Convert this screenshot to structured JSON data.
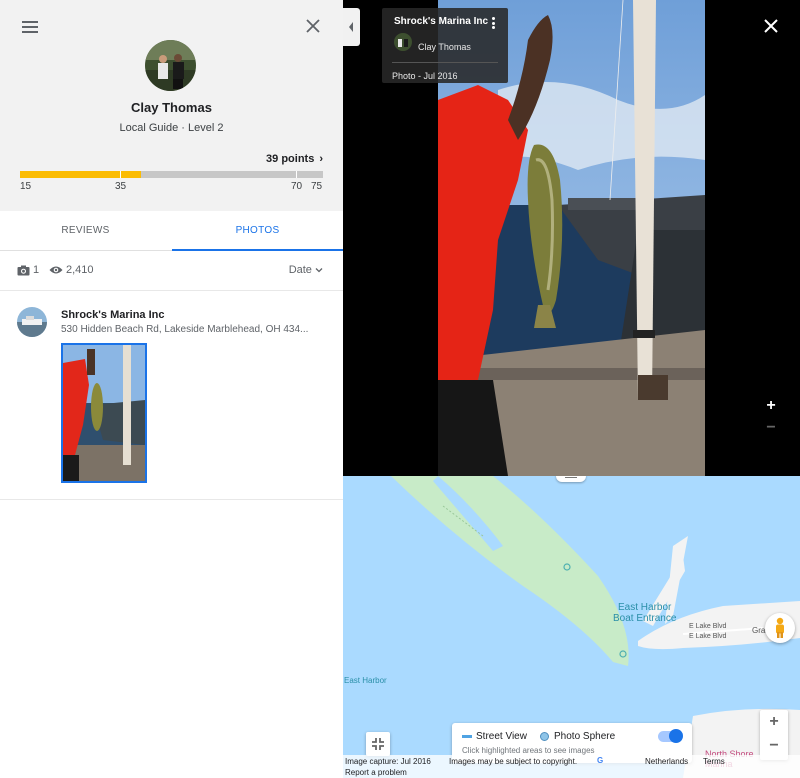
{
  "profile": {
    "name": "Clay Thomas",
    "level": "Local Guide · Level 2",
    "points_label": "39 points",
    "progress": {
      "current_points": 39,
      "max_points": 75,
      "fill_fraction": 0.4,
      "tick_labels": [
        "15",
        "35",
        "70",
        "75"
      ]
    }
  },
  "tabs": [
    {
      "label": "REVIEWS",
      "active": false
    },
    {
      "label": "PHOTOS",
      "active": true
    }
  ],
  "stats": {
    "photo_count": "1",
    "view_count": "2,410",
    "sort_label": "Date"
  },
  "entry": {
    "place_name": "Shrock's Marina Inc",
    "address": "530 Hidden Beach Rd, Lakeside Marblehead, OH 434..."
  },
  "viewer": {
    "place_name": "Shrock's Marina Inc",
    "user_name": "Clay Thomas",
    "date_label": "Photo - Jul 2016"
  },
  "map": {
    "labels": {
      "harbor_entrance": "East Harbor\nBoat Entrance",
      "east_harbor": "East Harbor",
      "road1": "E Lake Blvd",
      "road2": "E Lake Blvd",
      "road3": "Grav",
      "north_shore": "North Shore\nMarina"
    },
    "layers": {
      "street_view": "Street View",
      "photo_sphere": "Photo Sphere",
      "hint": "Click highlighted areas to see images",
      "toggle_on": true
    },
    "footer": {
      "capture": "Image capture: Jul 2016",
      "copyright": "Images may be subject to copyright.",
      "country": "Netherlands",
      "terms": "Terms",
      "report": "Report a problem"
    }
  },
  "colors": {
    "accent": "#1a73e8",
    "progress_fill": "#fbbc04",
    "water": "#aadaff",
    "land_green": "#c8ebc8"
  }
}
